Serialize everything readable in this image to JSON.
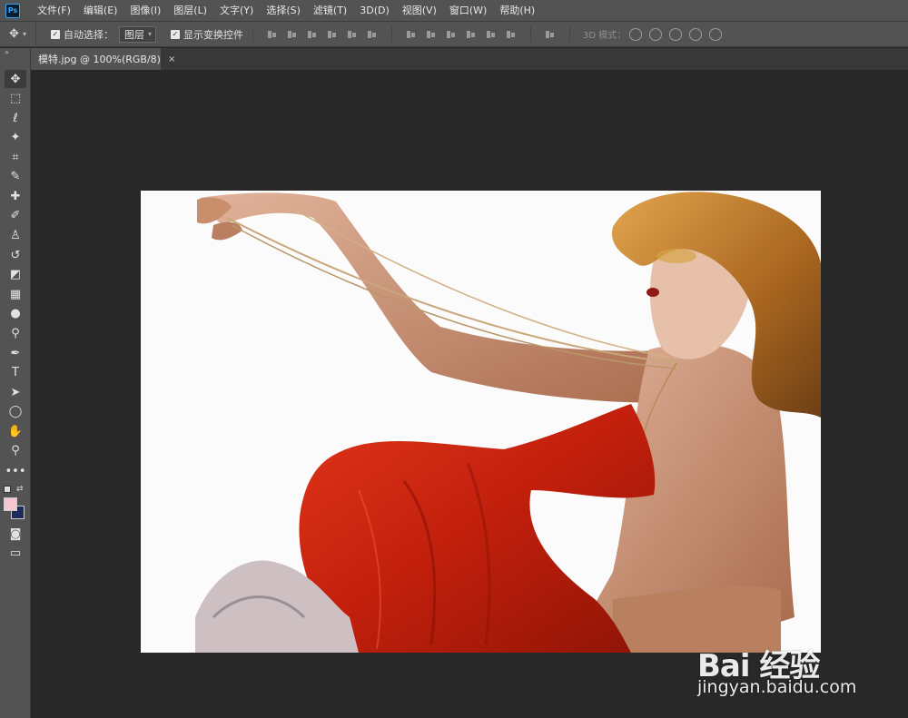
{
  "app": {
    "logo": "Ps",
    "menus": [
      "文件(F)",
      "编辑(E)",
      "图像(I)",
      "图层(L)",
      "文字(Y)",
      "选择(S)",
      "滤镜(T)",
      "3D(D)",
      "视图(V)",
      "窗口(W)",
      "帮助(H)"
    ]
  },
  "options": {
    "auto_select_label": "自动选择：",
    "auto_select_checked": true,
    "layer_dropdown": "图层",
    "show_transform_label": "显示变换控件",
    "show_transform_checked": true,
    "mode_3d_label": "3D 模式："
  },
  "document": {
    "tab_title": "模特.jpg @ 100%(RGB/8)",
    "close_glyph": "×"
  },
  "colors": {
    "foreground": "#f6c7cf",
    "background": "#1b2b5e",
    "dress": "#c8230f",
    "hair": "#b8782a",
    "skin": "#c98e6c"
  },
  "watermark": {
    "logo_text": "Bai 经验",
    "url": "jingyan.baidu.com"
  }
}
